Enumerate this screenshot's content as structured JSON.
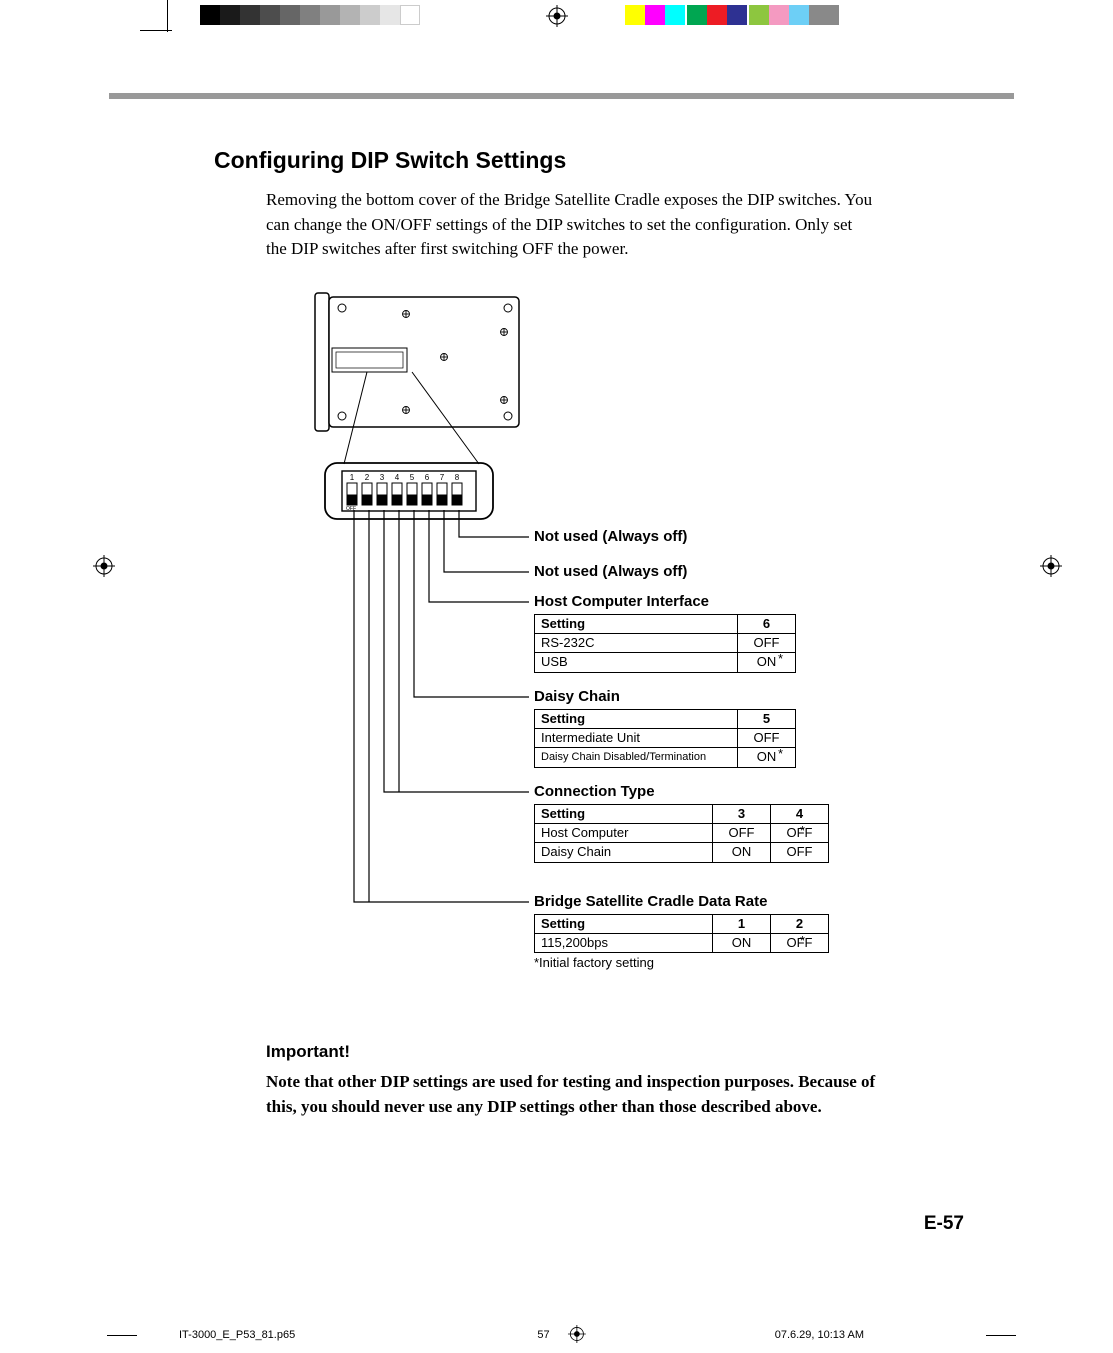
{
  "heading": "Configuring DIP Switch Settings",
  "intro": "Removing the bottom cover of the Bridge Satellite Cradle exposes the DIP switches. You can change the ON/OFF settings of the DIP switches to set the configuration. Only set the DIP switches after first switching OFF the power.",
  "dip_numbers": [
    "1",
    "2",
    "3",
    "4",
    "5",
    "6",
    "7",
    "8"
  ],
  "dip_off_label": "OFF",
  "labels": {
    "sw8": "Not used (Always off)",
    "sw7": "Not used (Always off)",
    "sw6": {
      "title": "Host Computer Interface",
      "cols": [
        "Setting",
        "6"
      ],
      "rows": [
        [
          "RS-232C",
          "OFF"
        ],
        [
          "USB",
          "ON"
        ]
      ],
      "asterisk_row": 1
    },
    "sw5": {
      "title": "Daisy Chain",
      "cols": [
        "Setting",
        "5"
      ],
      "rows": [
        [
          "Intermediate Unit",
          "OFF"
        ],
        [
          "Daisy Chain Disabled/Termination",
          "ON"
        ]
      ],
      "asterisk_row": 1
    },
    "sw34": {
      "title": "Connection Type",
      "cols": [
        "Setting",
        "3",
        "4"
      ],
      "rows": [
        [
          "Host Computer",
          "OFF",
          "OFF"
        ],
        [
          "Daisy Chain",
          "ON",
          "OFF"
        ]
      ],
      "asterisk_row": 0
    },
    "sw12": {
      "title": "Bridge Satellite Cradle Data Rate",
      "cols": [
        "Setting",
        "1",
        "2"
      ],
      "rows": [
        [
          "115,200bps",
          "ON",
          "OFF"
        ]
      ],
      "asterisk_row": 0,
      "footnote": "*Initial factory setting"
    }
  },
  "important_heading": "Important!",
  "important_body": "Note that other DIP settings are used for testing and inspection purposes. Because of this, you should never use any DIP settings other than those described above.",
  "page_number": "E-57",
  "slug": {
    "file": "IT-3000_E_P53_81.p65",
    "page": "57",
    "timestamp": "07.6.29, 10:13 AM"
  }
}
